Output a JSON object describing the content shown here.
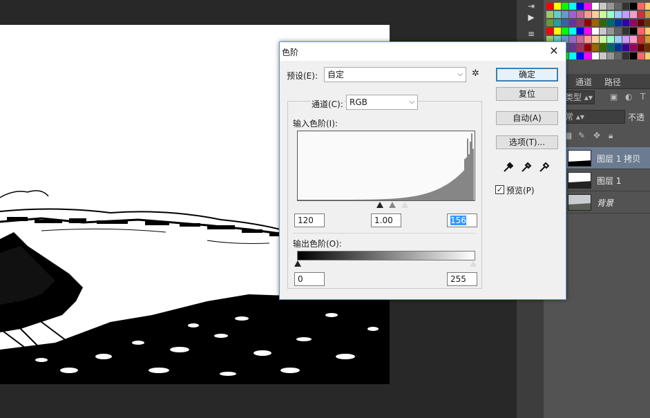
{
  "dialog": {
    "title": "色阶",
    "close_glyph": "✕",
    "preset_label": "预设(E):",
    "preset_value": "自定",
    "gear_glyph": "✲",
    "channel_label": "通道(C):",
    "channel_value": "RGB",
    "input_levels_label": "输入色阶(I):",
    "input_black": "120",
    "input_gamma": "1.00",
    "input_white": "156",
    "output_levels_label": "输出色阶(O):",
    "output_black": "0",
    "output_white": "255",
    "buttons": {
      "ok": "确定",
      "reset": "复位",
      "auto": "自动(A)",
      "options": "选项(T)..."
    },
    "preview_label": "预览(P)",
    "preview_checked": true,
    "eyedroppers": [
      "black-point-eyedropper-icon",
      "gray-point-eyedropper-icon",
      "white-point-eyedropper-icon"
    ]
  },
  "panels": {
    "tabs": [
      "通道",
      "路径"
    ],
    "filter_kind": "类型",
    "opacity_label": "不透",
    "lock_label": "锁",
    "layers": [
      {
        "name": "图层 1 拷贝",
        "selected": true
      },
      {
        "name": "图层 1",
        "selected": false
      },
      {
        "name": "背景",
        "selected": false
      }
    ]
  },
  "colors": {
    "accent": "#3c7fb1",
    "selected_layer": "#6b7b91",
    "panel_bg": "#535353",
    "workspace_bg": "#282828"
  }
}
